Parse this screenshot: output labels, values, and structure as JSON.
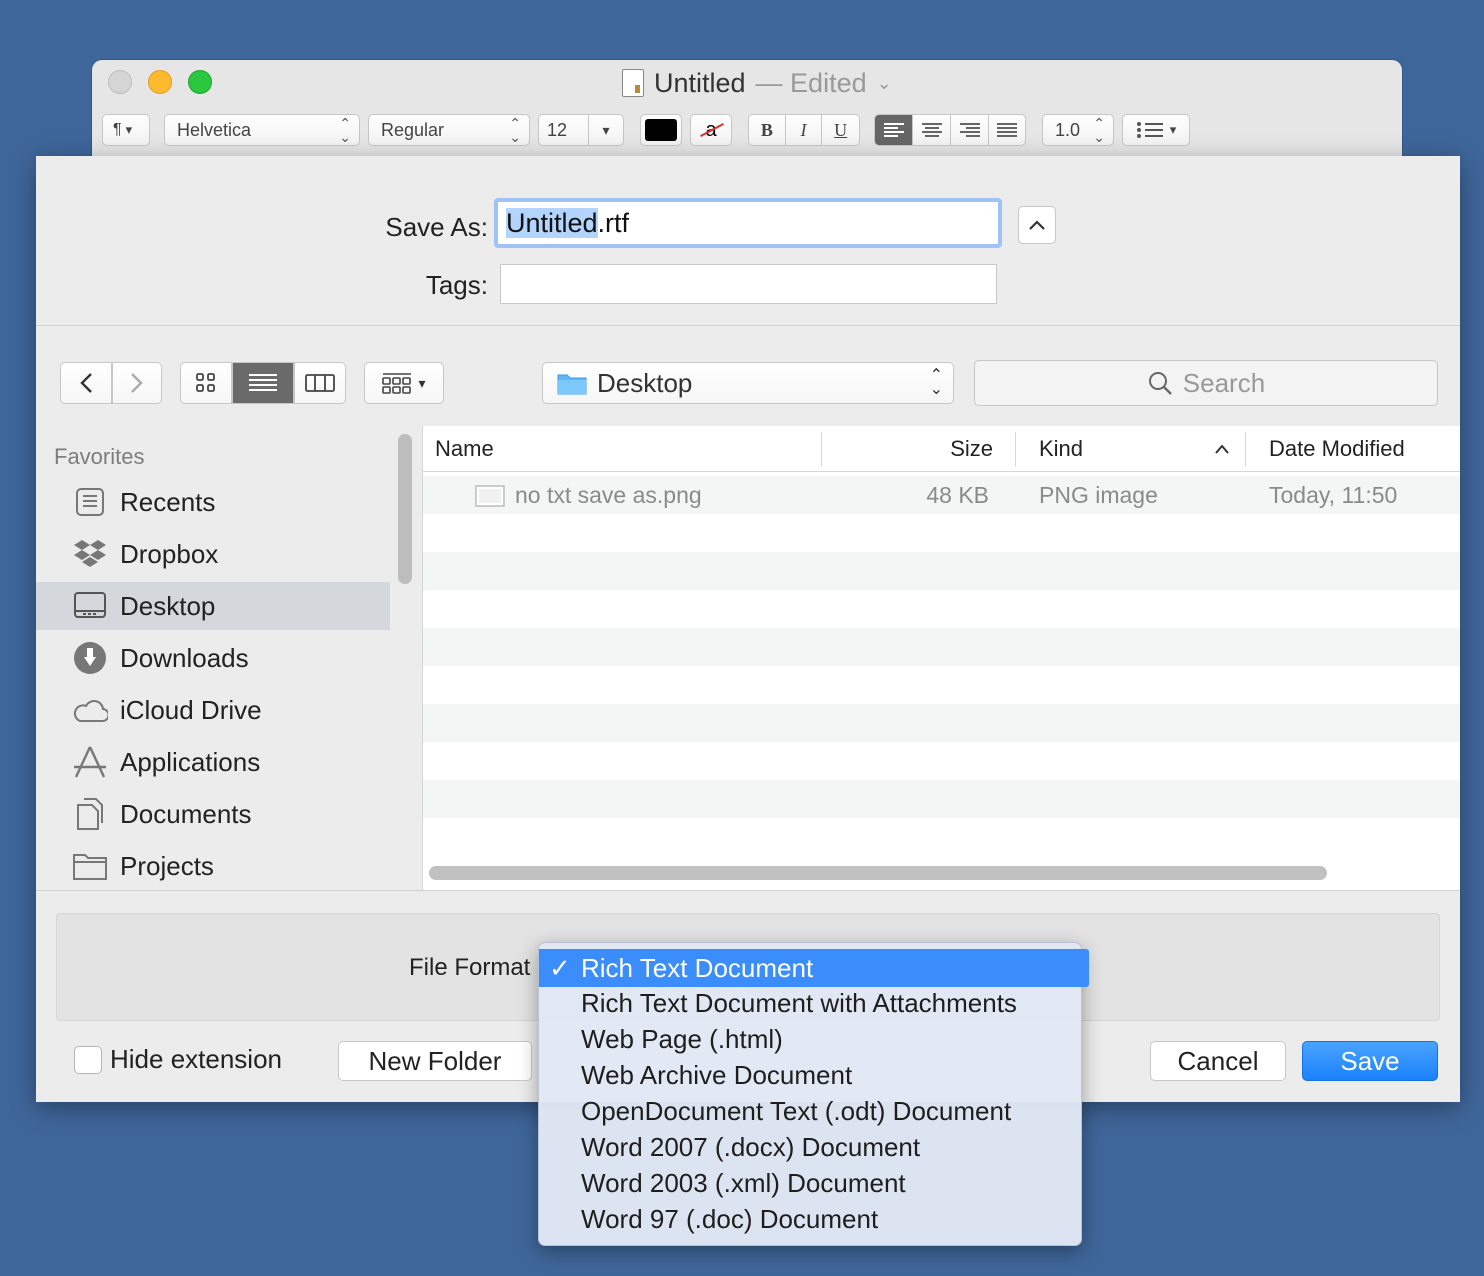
{
  "window": {
    "title": "Untitled",
    "title_status": "— Edited",
    "toolbar": {
      "paragraph_symbol": "¶",
      "font_family": "Helvetica",
      "font_style": "Regular",
      "font_size": "12",
      "line_spacing": "1.0",
      "bold": "B",
      "italic": "I",
      "underline": "U",
      "text_color": "#000000",
      "highlight_glyph": "a"
    }
  },
  "sheet": {
    "save_as_label": "Save As:",
    "save_as_value_selected": "Untitled",
    "save_as_value_ext": ".rtf",
    "tags_label": "Tags:",
    "location": "Desktop",
    "search_placeholder": "Search",
    "sidebar": {
      "heading": "Favorites",
      "items": [
        {
          "label": "Recents",
          "icon": "recents-icon"
        },
        {
          "label": "Dropbox",
          "icon": "dropbox-icon"
        },
        {
          "label": "Desktop",
          "icon": "desktop-icon",
          "selected": true
        },
        {
          "label": "Downloads",
          "icon": "downloads-icon"
        },
        {
          "label": "iCloud Drive",
          "icon": "cloud-icon"
        },
        {
          "label": "Applications",
          "icon": "applications-icon"
        },
        {
          "label": "Documents",
          "icon": "documents-icon"
        },
        {
          "label": "Projects",
          "icon": "folder-icon"
        }
      ]
    },
    "columns": {
      "name": "Name",
      "size": "Size",
      "kind": "Kind",
      "date": "Date Modified"
    },
    "files": [
      {
        "name": "no txt save as.png",
        "size": "48 KB",
        "kind": "PNG image",
        "date": "Today, 11:50"
      }
    ],
    "file_format_label": "File Format",
    "hide_extension_label": "Hide extension",
    "new_folder_label": "New Folder",
    "cancel_label": "Cancel",
    "save_label": "Save"
  },
  "format_menu": {
    "check": "✓",
    "options": [
      "Rich Text Document",
      "Rich Text Document with Attachments",
      "Web Page (.html)",
      "Web Archive Document",
      "OpenDocument Text (.odt) Document",
      "Word 2007 (.docx) Document",
      "Word 2003 (.xml) Document",
      "Word 97 (.doc) Document"
    ],
    "selected_index": 0
  },
  "colors": {
    "desktop_bg": "#3f669a",
    "accent": "#3a8dfb",
    "selection": "#b3d4fd"
  }
}
